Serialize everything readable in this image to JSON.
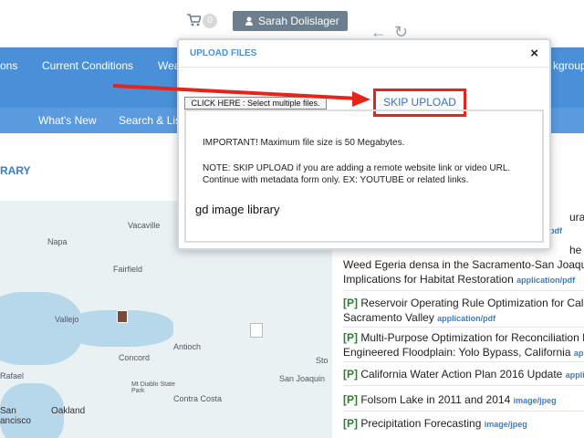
{
  "topbar": {
    "cart_count": "0",
    "user_name": "Sarah Dolislager",
    "back_glyph": "←",
    "forward_glyph": "↻"
  },
  "nav1": {
    "items": [
      "ons",
      "Current Conditions",
      "Wea",
      "kgroup"
    ]
  },
  "nav2": {
    "items": [
      "What's New",
      "Search & Lis"
    ]
  },
  "library_title": "RARY",
  "map": {
    "labels": [
      "Vacaville",
      "Napa",
      "Fairfield",
      "Vallejo",
      "Rafael",
      "Antioch",
      "Concord",
      "Mt Diablo State Park",
      "Contra Costa",
      "Sto",
      "San Joaquin",
      "Oakland",
      "San",
      "ancisco"
    ]
  },
  "results": [
    {
      "tag": "",
      "text": "ural Flo",
      "mime": "n/pdf"
    },
    {
      "tag": "",
      "text": "he Subm",
      "mime": ""
    },
    {
      "tag": "",
      "text": "Weed Egeria densa in the Sacramento-San Joaquin",
      "mime": ""
    },
    {
      "tag": "",
      "text": "Implications for Habitat Restoration",
      "mime": "application/pdf"
    },
    {
      "tag": "[P]",
      "text": "Reservoir Operating Rule Optimization for Califo",
      "mime": ""
    },
    {
      "tag": "",
      "text": "Sacramento Valley",
      "mime": "application/pdf"
    },
    {
      "tag": "[P]",
      "text": "Multi-Purpose Optimization for Reconciliation Ec",
      "mime": ""
    },
    {
      "tag": "",
      "text": "Engineered Floodplain: Yolo Bypass, California",
      "mime": "applic"
    },
    {
      "tag": "[P]",
      "text": "California Water Action Plan 2016 Update",
      "mime": "applicat"
    },
    {
      "tag": "[P]",
      "text": "Folsom Lake in 2011 and 2014",
      "mime": "image/jpeg"
    },
    {
      "tag": "[P]",
      "text": "Precipitation Forecasting",
      "mime": "image/jpeg"
    }
  ],
  "modal": {
    "title": "UPLOAD FILES",
    "close_glyph": "×",
    "select_files_label": "CLICK HERE : Select multiple files.",
    "skip_upload_label": "SKIP UPLOAD",
    "important_note": "IMPORTANT! Maximum file size is 50 Megabytes.",
    "skip_note_line1": "NOTE: SKIP UPLOAD if you are adding a remote website link or video URL.",
    "skip_note_line2": "Continue with metadata form only. EX: YOUTUBE or related links.",
    "library_name": "gd image library"
  },
  "colors": {
    "nav": "#4a90d9",
    "annotation_red": "#e8231a",
    "tag_green": "#2e7d32"
  }
}
